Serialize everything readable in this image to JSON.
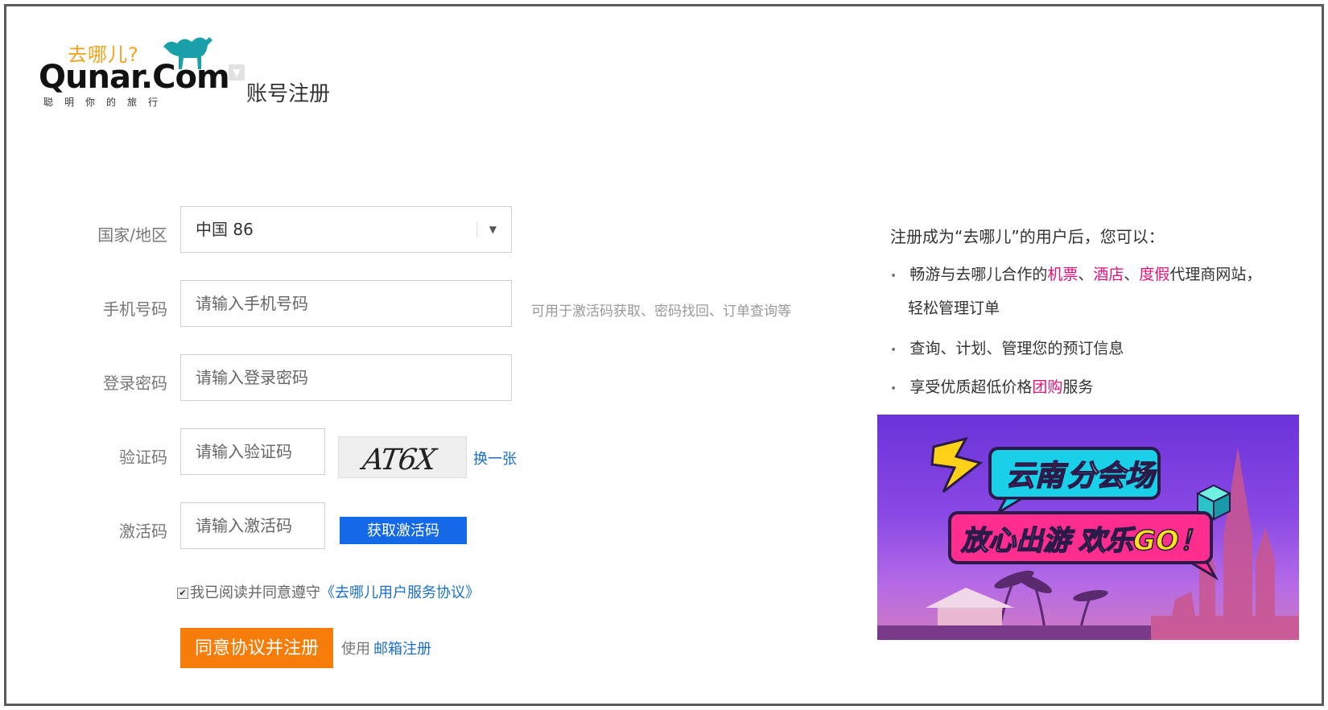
{
  "header": {
    "logo_cn": "去哪儿?",
    "logo_en": "Qunar.Com",
    "logo_tagline": "聪明你的旅行",
    "page_title": "账号注册"
  },
  "form": {
    "country": {
      "label": "国家/地区",
      "value": "中国 86"
    },
    "phone": {
      "label": "手机号码",
      "placeholder": "请输入手机号码",
      "hint": "可用于激活码获取、密码找回、订单查询等"
    },
    "password": {
      "label": "登录密码",
      "placeholder": "请输入登录密码"
    },
    "captcha": {
      "label": "验证码",
      "placeholder": "请输入验证码",
      "image_text": "AT6X",
      "refresh_label": "换一张"
    },
    "activation": {
      "label": "激活码",
      "placeholder": "请输入激活码",
      "get_button": "获取激活码"
    },
    "agreement": {
      "checked": true,
      "text": "我已阅读并同意遵守",
      "link": "《去哪儿用户服务协议》"
    },
    "submit_label": "同意协议并注册",
    "alt_prefix": "使用",
    "alt_link": "邮箱注册"
  },
  "benefits": {
    "title": "注册成为“去哪儿”的用户后，您可以：",
    "items": [
      {
        "pre": "畅游与去哪儿合作的",
        "hl1": "机票",
        "sep1": "、",
        "hl2": "酒店",
        "sep2": "、",
        "hl3": "度假",
        "post": "代理商网站，",
        "cont": "轻松管理订单"
      },
      {
        "text": "查询、计划、管理您的预订信息"
      },
      {
        "pre": "享受优质超低价格",
        "hl": "团购",
        "post": "服务"
      }
    ]
  },
  "banner": {
    "line1_a": "云南",
    "line1_b": "分会场",
    "line2_a": "放心出游",
    "line2_b": "欢乐GO！"
  },
  "colors": {
    "accent_orange": "#f67d0a",
    "accent_blue": "#1369e8",
    "link_blue": "#1a6fc9",
    "highlight_pink": "#e0127b",
    "logo_orange": "#f4a21a"
  }
}
